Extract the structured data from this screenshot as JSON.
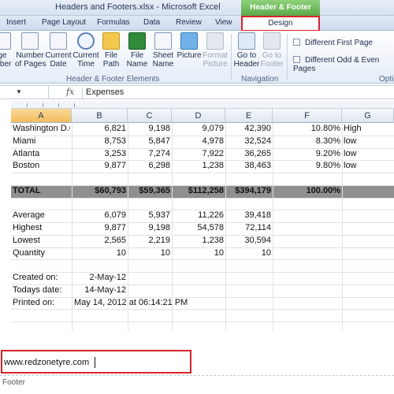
{
  "window": {
    "title": "Headers and Footers.xlsx - Microsoft Excel",
    "contextual_group": "Header & Footer Tools"
  },
  "tabs": [
    "Insert",
    "Page Layout",
    "Formulas",
    "Data",
    "Review",
    "View",
    "Design"
  ],
  "ribbon": {
    "buttons": [
      {
        "label": "ge\nmber",
        "icon": "page-number-icon",
        "disabled": false
      },
      {
        "label": "Number\nof Pages",
        "icon": "number-of-pages-icon",
        "disabled": false
      },
      {
        "label": "Current\nDate",
        "icon": "calendar-icon",
        "disabled": false
      },
      {
        "label": "Current\nTime",
        "icon": "clock-icon",
        "disabled": false
      },
      {
        "label": "File\nPath",
        "icon": "folder-icon",
        "disabled": false
      },
      {
        "label": "File\nName",
        "icon": "excel-file-icon",
        "disabled": false
      },
      {
        "label": "Sheet\nName",
        "icon": "sheet-icon",
        "disabled": false
      },
      {
        "label": "Picture",
        "icon": "picture-icon",
        "disabled": false
      },
      {
        "label": "Format\nPicture",
        "icon": "format-picture-icon",
        "disabled": true
      },
      {
        "label": "Go to\nHeader",
        "icon": "go-to-header-icon",
        "disabled": false
      },
      {
        "label": "Go to\nFooter",
        "icon": "go-to-footer-icon",
        "disabled": true
      }
    ],
    "group_elements": "Header & Footer Elements",
    "group_navigation": "Navigation",
    "group_options": "Optio",
    "opt_first_page": "Different First Page",
    "opt_odd_even": "Different Odd & Even Pages"
  },
  "formula_bar": {
    "fx": "fx",
    "value": "Expenses"
  },
  "columns": [
    "A",
    "B",
    "C",
    "D",
    "E",
    "F",
    "G"
  ],
  "rows": [
    [
      "Washington D.C",
      "6,821",
      "9,198",
      "9,079",
      "42,390",
      "10.80%",
      "High"
    ],
    [
      "Miami",
      "8,753",
      "5,847",
      "4,978",
      "32,524",
      "8.30%",
      "low"
    ],
    [
      "Atlanta",
      "3,253",
      "7,274",
      "7,922",
      "36,265",
      "9.20%",
      "low"
    ],
    [
      "Boston",
      "9,877",
      "6,298",
      "1,238",
      "38,463",
      "9.80%",
      "low"
    ],
    [
      "",
      "",
      "",
      "",
      "",
      "",
      ""
    ],
    [
      "TOTAL",
      "$60,793",
      "$59,365",
      "$112,258",
      "$394,179",
      "100.00%",
      ""
    ],
    [
      "",
      "",
      "",
      "",
      "",
      "",
      ""
    ],
    [
      "Average",
      "6,079",
      "5,937",
      "11,226",
      "39,418",
      "",
      ""
    ],
    [
      "Highest",
      "9,877",
      "9,198",
      "54,578",
      "72,114",
      "",
      ""
    ],
    [
      "Lowest",
      "2,565",
      "2,219",
      "1,238",
      "30,594",
      "",
      ""
    ],
    [
      "Quantity",
      "10",
      "10",
      "10",
      "10",
      "",
      ""
    ],
    [
      "",
      "",
      "",
      "",
      "",
      "",
      ""
    ],
    [
      "Created on:",
      "2-May-12",
      "",
      "",
      "",
      "",
      ""
    ],
    [
      "Todays date:",
      "14-May-12",
      "",
      "",
      "",
      "",
      ""
    ],
    [
      "Printed on:",
      "May 14, 2012 at 06:14:21 PM",
      "",
      "",
      "",
      "",
      ""
    ]
  ],
  "footer": {
    "text": "www.redzonetyre.com",
    "label": "Footer"
  }
}
